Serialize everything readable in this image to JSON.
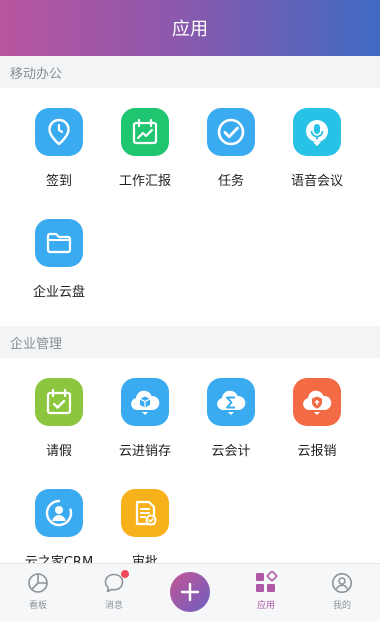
{
  "header": {
    "title": "应用"
  },
  "sections": [
    {
      "title": "移动办公",
      "apps": [
        {
          "label": "签到",
          "icon": "location-clock-icon",
          "color": "#3aabf1"
        },
        {
          "label": "工作汇报",
          "icon": "calendar-chart-icon",
          "color": "#1fc56f"
        },
        {
          "label": "任务",
          "icon": "check-circle-icon",
          "color": "#3aabf1"
        },
        {
          "label": "语音会议",
          "icon": "microphone-icon",
          "color": "#27c2e6"
        },
        {
          "label": "企业云盘",
          "icon": "folder-icon",
          "color": "#3aabf1"
        }
      ]
    },
    {
      "title": "企业管理",
      "apps": [
        {
          "label": "请假",
          "icon": "calendar-check-icon",
          "color": "#8cc63f"
        },
        {
          "label": "云进销存",
          "icon": "cloud-box-icon",
          "color": "#3aabf1"
        },
        {
          "label": "云会计",
          "icon": "cloud-sigma-icon",
          "color": "#3aabf1"
        },
        {
          "label": "云报销",
          "icon": "cloud-shield-icon",
          "color": "#f26b44"
        },
        {
          "label": "云之家CRM",
          "icon": "user-circle-icon",
          "color": "#3aabf1"
        },
        {
          "label": "审批",
          "icon": "document-check-icon",
          "color": "#f7b21b"
        }
      ]
    }
  ],
  "tabbar": {
    "items": [
      {
        "label": "看板",
        "icon": "pie-chart-icon"
      },
      {
        "label": "消息",
        "icon": "chat-bubble-icon"
      },
      {
        "label": "",
        "icon": "plus-icon"
      },
      {
        "label": "应用",
        "icon": "apps-grid-icon"
      },
      {
        "label": "我的",
        "icon": "user-icon"
      }
    ],
    "active_index": 3
  }
}
